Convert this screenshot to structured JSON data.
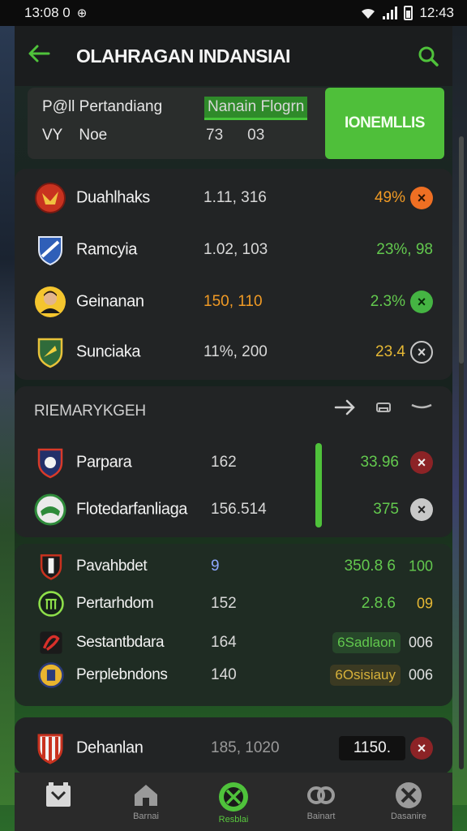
{
  "status": {
    "left_time": "13:08 0",
    "time": "12:43"
  },
  "header": {
    "title": "OLAHRAGAN INDANSIAI"
  },
  "summary": {
    "label1": "P@ll Pertandiang",
    "label2a": "VY",
    "label2b": "Noe",
    "highlight": "Nanain Flogrn",
    "num1": "73",
    "num2": "03",
    "button": "IONEMLLIS"
  },
  "list1": [
    {
      "team": "Duahlhaks",
      "score": "1.11, 316",
      "pct": "49%",
      "pct_color": "orange",
      "action": "×",
      "action_style": "orange"
    },
    {
      "team": "Ramcyia",
      "score": "1.02, 103",
      "pct": "23%, 98",
      "pct_color": "green",
      "action": "",
      "action_style": "none"
    },
    {
      "team": "Geinanan",
      "score": "150, 110",
      "pct": "2.3%",
      "pct_color": "green",
      "action": "×",
      "action_style": "green"
    },
    {
      "team": "Sunciaka",
      "score": "11%, 200",
      "pct": "23.4",
      "pct_color": "yellow",
      "action": "×",
      "action_style": "outline"
    }
  ],
  "section2": {
    "title": "RIEMARYKGEH",
    "rows": [
      {
        "team": "Parpara",
        "score": "162",
        "pct": "33.96",
        "action": "×",
        "action_style": "red"
      },
      {
        "team": "Flotedarfanliaga",
        "score": "156.514",
        "pct": "375",
        "action": "×",
        "action_style": "grey"
      }
    ]
  },
  "section3": {
    "rows": [
      {
        "team": "Pavahbdet",
        "score": "9",
        "right": "350.8 6",
        "tail": "100"
      },
      {
        "team": "Pertarhdom",
        "score": "152",
        "right": "2.8.6",
        "tail": "09"
      },
      {
        "team": "Sestantbdara",
        "score": "164",
        "pill": "6Sadlaon",
        "pill_style": "g",
        "tail": "006"
      },
      {
        "team": "Perplebndons",
        "score": "140",
        "pill": "6Osisiauy",
        "pill_style": "y",
        "tail": "006"
      }
    ]
  },
  "section4": {
    "team": "Dehanlan",
    "score": "185, 1020",
    "right": "1150.",
    "action": "×"
  },
  "nav": [
    {
      "label": "",
      "icon": "scoreboard-icon"
    },
    {
      "label": "Barnai",
      "icon": "home-icon"
    },
    {
      "label": "Resblai",
      "icon": "soccer-ball-icon",
      "active": true
    },
    {
      "label": "Bainart",
      "icon": "controller-icon"
    },
    {
      "label": "Dasanire",
      "icon": "ball-icon"
    }
  ],
  "colors": {
    "accent": "#4fbf3a",
    "orange": "#f09a25",
    "yellow": "#e6b834",
    "bg": "#222425"
  }
}
